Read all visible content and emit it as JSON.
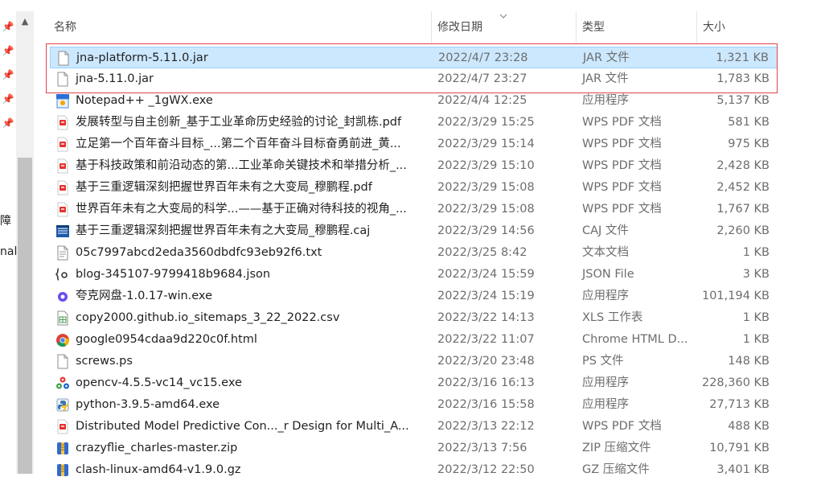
{
  "nav": {
    "fragment_1": "障",
    "fragment_2": "nal",
    "pins": [
      "pin-icon",
      "pin-icon",
      "pin-icon",
      "pin-icon",
      "pin-icon"
    ]
  },
  "columns": {
    "name": "名称",
    "date": "修改日期",
    "type": "类型",
    "size": "大小"
  },
  "files": [
    {
      "name": "jna-platform-5.11.0.jar",
      "date": "2022/4/7 23:28",
      "type": "JAR 文件",
      "size": "1,321 KB",
      "icon": "file-icon",
      "selected": true
    },
    {
      "name": "jna-5.11.0.jar",
      "date": "2022/4/7 23:27",
      "type": "JAR 文件",
      "size": "1,783 KB",
      "icon": "file-icon",
      "selected": false
    },
    {
      "name": "Notepad++ _1gWX.exe",
      "date": "2022/4/4 12:25",
      "type": "应用程序",
      "size": "5,137 KB",
      "icon": "setup-icon",
      "selected": false
    },
    {
      "name": "发展转型与自主创新_基于工业革命历史经验的讨论_封凯栋.pdf",
      "date": "2022/3/29 15:25",
      "type": "WPS PDF 文档",
      "size": "581 KB",
      "icon": "pdf-icon",
      "selected": false
    },
    {
      "name": "立足第一个百年奋斗目标_...第二个百年奋斗目标奋勇前进_黄...",
      "date": "2022/3/29 15:14",
      "type": "WPS PDF 文档",
      "size": "975 KB",
      "icon": "pdf-icon",
      "selected": false
    },
    {
      "name": "基于科技政策和前沿动态的第...工业革命关键技术和举措分析_...",
      "date": "2022/3/29 15:10",
      "type": "WPS PDF 文档",
      "size": "2,428 KB",
      "icon": "pdf-icon",
      "selected": false
    },
    {
      "name": "基于三重逻辑深刻把握世界百年未有之大变局_穆鹏程.pdf",
      "date": "2022/3/29 15:08",
      "type": "WPS PDF 文档",
      "size": "2,452 KB",
      "icon": "pdf-icon",
      "selected": false
    },
    {
      "name": "世界百年未有之大变局的科学...——基于正确对待科技的视角_...",
      "date": "2022/3/29 15:08",
      "type": "WPS PDF 文档",
      "size": "1,767 KB",
      "icon": "pdf-icon",
      "selected": false
    },
    {
      "name": "基于三重逻辑深刻把握世界百年未有之大变局_穆鹏程.caj",
      "date": "2022/3/29 14:56",
      "type": "CAJ 文件",
      "size": "2,260 KB",
      "icon": "caj-icon",
      "selected": false
    },
    {
      "name": "05c7997abcd2eda3560dbdfc93eb92f6.txt",
      "date": "2022/3/25 8:42",
      "type": "文本文档",
      "size": "1 KB",
      "icon": "text-file-icon",
      "selected": false
    },
    {
      "name": "blog-345107-9799418b9684.json",
      "date": "2022/3/24 15:59",
      "type": "JSON File",
      "size": "3 KB",
      "icon": "json-icon",
      "selected": false
    },
    {
      "name": "夸克网盘-1.0.17-win.exe",
      "date": "2022/3/24 15:19",
      "type": "应用程序",
      "size": "101,194 KB",
      "icon": "quark-icon",
      "selected": false
    },
    {
      "name": "copy2000.github.io_sitemaps_3_22_2022.csv",
      "date": "2022/3/22 14:13",
      "type": "XLS 工作表",
      "size": "1 KB",
      "icon": "spreadsheet-icon",
      "selected": false
    },
    {
      "name": "google0954cdaa9d220c0f.html",
      "date": "2022/3/22 11:07",
      "type": "Chrome HTML D...",
      "size": "1 KB",
      "icon": "chrome-icon",
      "selected": false
    },
    {
      "name": "screws.ps",
      "date": "2022/3/20 23:48",
      "type": "PS 文件",
      "size": "148 KB",
      "icon": "file-icon",
      "selected": false
    },
    {
      "name": "opencv-4.5.5-vc14_vc15.exe",
      "date": "2022/3/16 16:13",
      "type": "应用程序",
      "size": "228,360 KB",
      "icon": "opencv-icon",
      "selected": false
    },
    {
      "name": "python-3.9.5-amd64.exe",
      "date": "2022/3/16 15:58",
      "type": "应用程序",
      "size": "27,713 KB",
      "icon": "python-icon",
      "selected": false
    },
    {
      "name": "Distributed Model Predictive Con..._r Design for Multi_A...",
      "date": "2022/3/13 22:12",
      "type": "WPS PDF 文档",
      "size": "488 KB",
      "icon": "pdf-icon",
      "selected": false
    },
    {
      "name": "crazyflie_charles-master.zip",
      "date": "2022/3/13 7:56",
      "type": "ZIP 压缩文件",
      "size": "10,791 KB",
      "icon": "zip-icon",
      "selected": false
    },
    {
      "name": "clash-linux-amd64-v1.9.0.gz",
      "date": "2022/3/12 22:50",
      "type": "GZ 压缩文件",
      "size": "3,401 KB",
      "icon": "zip-icon",
      "selected": false
    }
  ],
  "colors": {
    "selection_bg": "#cce8ff",
    "selection_border": "#99d1ff",
    "annotation_border": "#e0454a",
    "pdf_red": "#e5322d"
  }
}
